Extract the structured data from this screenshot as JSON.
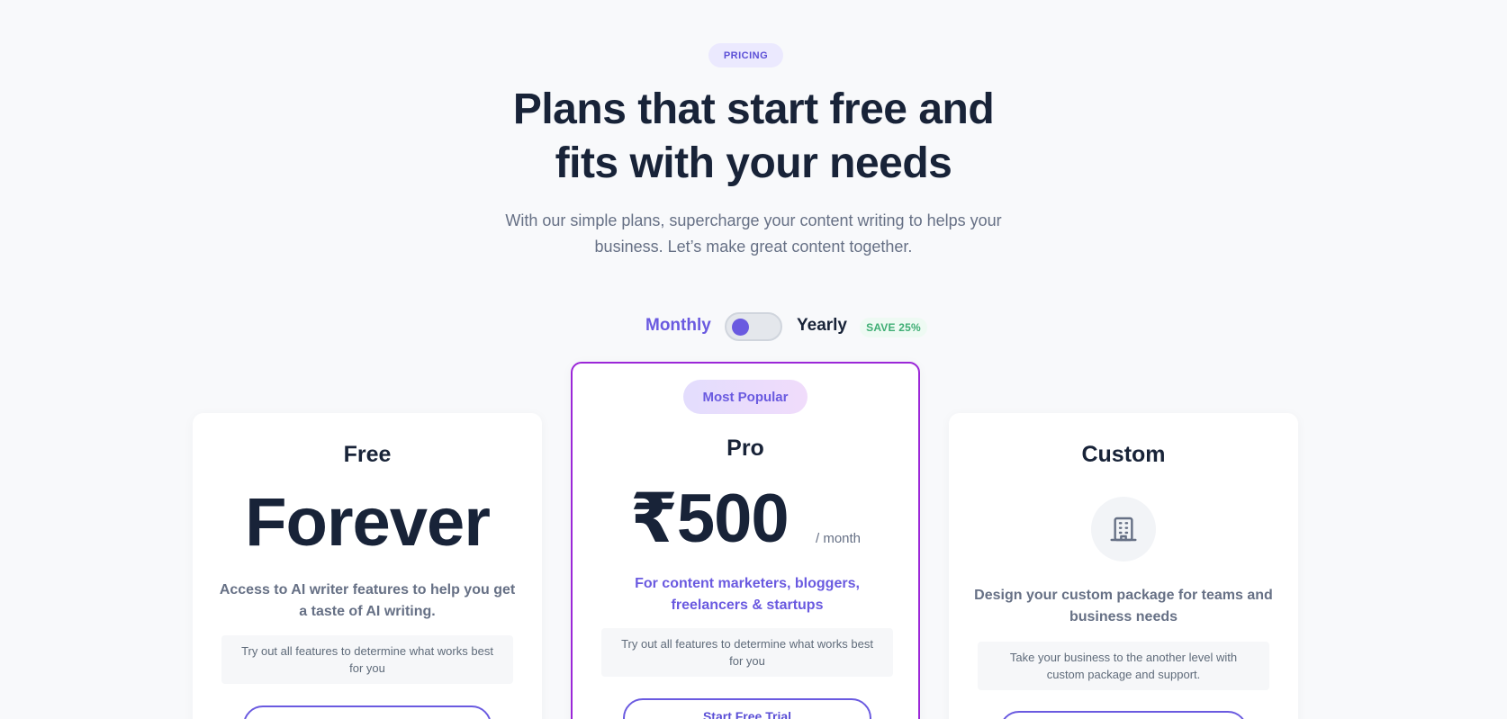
{
  "header": {
    "badge": "PRICING",
    "title_line1": "Plans that start free and",
    "title_line2": "fits with your needs",
    "subtitle_line1": "With our simple plans, supercharge your content writing to helps your",
    "subtitle_line2": "business. Let’s make great content together."
  },
  "billing": {
    "monthly_label": "Monthly",
    "yearly_label": "Yearly",
    "save_badge": "SAVE 25%",
    "selected": "Monthly"
  },
  "plans": [
    {
      "name": "Free",
      "price": "Forever",
      "description": "Access to AI writer features to help you get a taste of AI writing.",
      "note": "Try out all features to determine what works best for you",
      "cta": ""
    },
    {
      "badge": "Most Popular",
      "name": "Pro",
      "price": "₹500",
      "period": "/ month",
      "description": "For content marketers, bloggers, freelancers & startups",
      "note": "Try out all features to determine what works best for you",
      "cta": "Start Free Trial"
    },
    {
      "name": "Custom",
      "icon": "building-icon",
      "description": "Design your custom package for teams and business needs",
      "note": "Take your business to the another level with custom package and support.",
      "cta": ""
    }
  ],
  "colors": {
    "accent": "#6a5ae0",
    "highlight_border": "#9b27d8",
    "heading": "#182338",
    "muted": "#667085",
    "save_green": "#3fae74"
  }
}
